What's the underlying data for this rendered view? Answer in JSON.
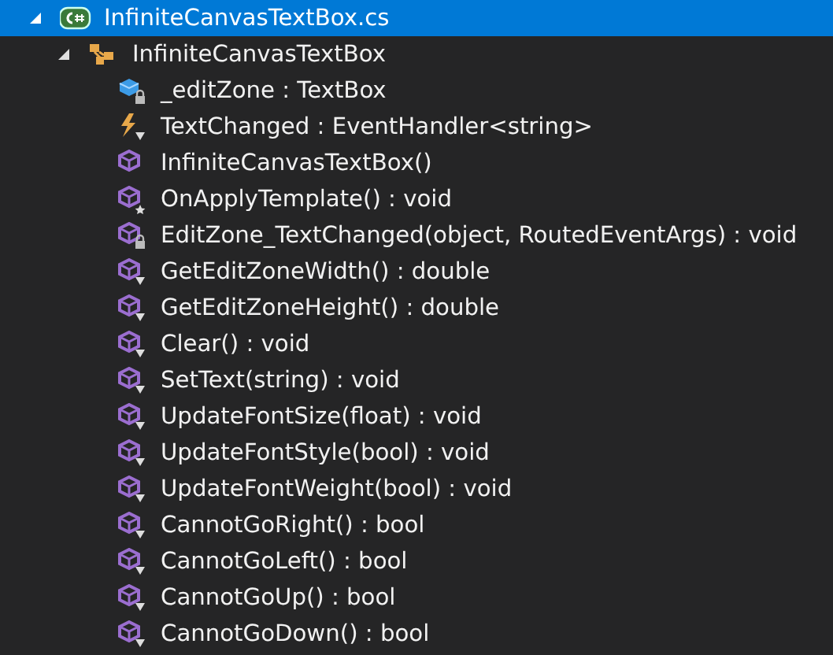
{
  "tree": [
    {
      "label": "InfiniteCanvasTextBox.cs",
      "kind": "file",
      "selected": true,
      "expanded": true,
      "children": [
        {
          "label": "InfiniteCanvasTextBox",
          "kind": "class",
          "selected": false,
          "expanded": true,
          "children": [
            {
              "label": "_editZone : TextBox",
              "kind": "field",
              "private": true,
              "internal": false,
              "protected": false,
              "selected": false
            },
            {
              "label": "TextChanged : EventHandler<string>",
              "kind": "event",
              "private": false,
              "internal": true,
              "protected": false,
              "selected": false
            },
            {
              "label": "InfiniteCanvasTextBox()",
              "kind": "method",
              "private": false,
              "internal": false,
              "protected": false,
              "selected": false
            },
            {
              "label": "OnApplyTemplate() : void",
              "kind": "method",
              "private": false,
              "internal": false,
              "protected": true,
              "selected": false
            },
            {
              "label": "EditZone_TextChanged(object, RoutedEventArgs) : void",
              "kind": "method",
              "private": true,
              "internal": false,
              "protected": false,
              "selected": false
            },
            {
              "label": "GetEditZoneWidth() : double",
              "kind": "method",
              "private": false,
              "internal": true,
              "protected": false,
              "selected": false
            },
            {
              "label": "GetEditZoneHeight() : double",
              "kind": "method",
              "private": false,
              "internal": true,
              "protected": false,
              "selected": false
            },
            {
              "label": "Clear() : void",
              "kind": "method",
              "private": false,
              "internal": true,
              "protected": false,
              "selected": false
            },
            {
              "label": "SetText(string) : void",
              "kind": "method",
              "private": false,
              "internal": true,
              "protected": false,
              "selected": false
            },
            {
              "label": "UpdateFontSize(float) : void",
              "kind": "method",
              "private": false,
              "internal": true,
              "protected": false,
              "selected": false
            },
            {
              "label": "UpdateFontStyle(bool) : void",
              "kind": "method",
              "private": false,
              "internal": true,
              "protected": false,
              "selected": false
            },
            {
              "label": "UpdateFontWeight(bool) : void",
              "kind": "method",
              "private": false,
              "internal": true,
              "protected": false,
              "selected": false
            },
            {
              "label": "CannotGoRight() : bool",
              "kind": "method",
              "private": false,
              "internal": true,
              "protected": false,
              "selected": false
            },
            {
              "label": "CannotGoLeft() : bool",
              "kind": "method",
              "private": false,
              "internal": true,
              "protected": false,
              "selected": false
            },
            {
              "label": "CannotGoUp() : bool",
              "kind": "method",
              "private": false,
              "internal": true,
              "protected": false,
              "selected": false
            },
            {
              "label": "CannotGoDown() : bool",
              "kind": "method",
              "private": false,
              "internal": true,
              "protected": false,
              "selected": false
            }
          ]
        }
      ]
    }
  ]
}
